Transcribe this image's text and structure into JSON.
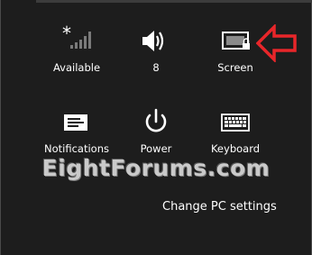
{
  "settings": {
    "tiles": [
      {
        "label": "Available",
        "icon": "network-signal-icon"
      },
      {
        "label": "8",
        "icon": "volume-icon"
      },
      {
        "label": "Screen",
        "icon": "screen-brightness-lock-icon"
      },
      {
        "label": "Notifications",
        "icon": "notifications-icon"
      },
      {
        "label": "Power",
        "icon": "power-icon"
      },
      {
        "label": "Keyboard",
        "icon": "keyboard-icon"
      }
    ],
    "change_pc_settings": "Change PC settings"
  },
  "watermark": {
    "text": "EightForums.com"
  },
  "annotation": {
    "icon": "red-arrow-icon",
    "color": "#e8262a"
  },
  "colors": {
    "background": "#1d1d1d",
    "text": "#ffffff"
  }
}
